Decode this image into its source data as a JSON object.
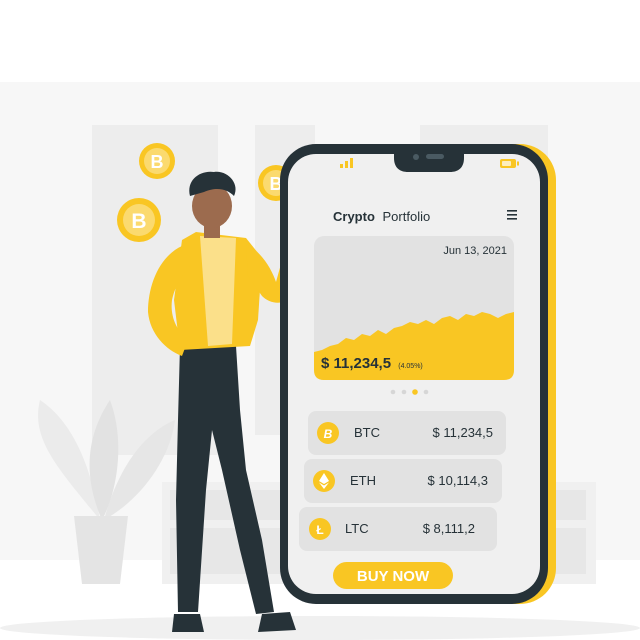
{
  "app": {
    "title_bold": "Crypto",
    "title_light": "Portfolio",
    "menu_icon": "hamburger-menu-icon",
    "signal_icon": "signal-bars-icon",
    "battery_icon": "battery-icon"
  },
  "chart": {
    "date": "Jun 13, 2021",
    "price": "$ 11,234,5",
    "change": "(4.05%)",
    "carousel_pages": 4,
    "active_page": 3
  },
  "coins": [
    {
      "symbol": "BTC",
      "value": "$ 11,234,5",
      "icon": "bitcoin-icon"
    },
    {
      "symbol": "ETH",
      "value": "$ 10,114,3",
      "icon": "ethereum-icon"
    },
    {
      "symbol": "LTC",
      "value": "$ 8,111,2",
      "icon": "litecoin-icon"
    }
  ],
  "cta": {
    "label": "BUY NOW"
  },
  "colors": {
    "accent": "#F9C623",
    "dark": "#263238",
    "screen": "#F0F0F0",
    "card": "#E2E2E2",
    "background_shapes": "#F2F2F2"
  }
}
